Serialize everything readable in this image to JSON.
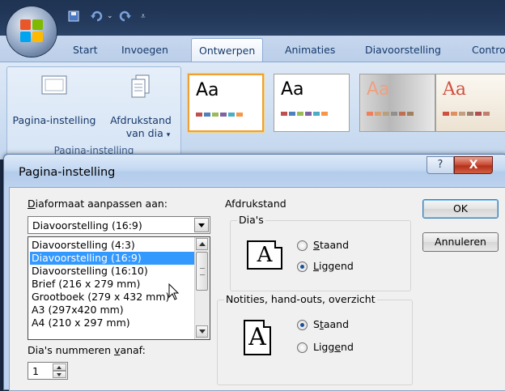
{
  "ribbon": {
    "tabs": [
      "Start",
      "Invoegen",
      "Ontwerpen",
      "Animaties",
      "Diavoorstelling",
      "Contro"
    ],
    "active_tab": "Ontwerpen",
    "page_setup_button": "Pagina-instelling",
    "orientation_button_line1": "Afdrukstand",
    "orientation_button_line2": "van dia",
    "group_label": "Pagina-instelling",
    "themes": [
      {
        "label": "Aa",
        "text_color": "#000000",
        "selected": true
      },
      {
        "label": "Aa",
        "text_color": "#000000",
        "selected": false
      },
      {
        "label": "Aa",
        "text_color": "#f0a080",
        "selected": false
      },
      {
        "label": "Aa",
        "text_color": "#d05040",
        "selected": false
      }
    ]
  },
  "dialog": {
    "title": "Pagina-instelling",
    "help_label": "?",
    "close_label": "X",
    "size_label_accel": "D",
    "size_label_rest": "iaformaat aanpassen aan:",
    "size_selected": "Diavoorstelling (16:9)",
    "size_options": [
      "Diavoorstelling (4:3)",
      "Diavoorstelling (16:9)",
      "Diavoorstelling (16:10)",
      "Brief (216 x 279 mm)",
      "Grootboek (279 x 432 mm)",
      "A3 (297x420 mm)",
      "A4 (210 x 297 mm)"
    ],
    "number_label_pre": "Dia's nummeren ",
    "number_label_accel": "v",
    "number_label_post": "anaf:",
    "number_value": "1",
    "orientation_title": "Afdrukstand",
    "slides_group": {
      "title": "Dia's",
      "icon_letter": "A",
      "option1_accel": "S",
      "option1_rest": "taand",
      "option2_accel": "L",
      "option2_rest": "iggend",
      "selected": "Liggend"
    },
    "notes_group": {
      "title": "Notities, hand-outs, overzicht",
      "icon_letter": "A",
      "option1_pre": "S",
      "option1_accel": "t",
      "option1_rest": "aand",
      "option2_pre": "Ligg",
      "option2_accel": "e",
      "option2_rest": "nd",
      "selected": "Staand"
    },
    "ok_label": "OK",
    "cancel_label": "Annuleren"
  },
  "colors": {
    "accent": "#3399ff",
    "theme_bar": [
      "#c0504d",
      "#9bbb59",
      "#8064a2",
      "#4bacc6",
      "#f79646",
      "#1f497d"
    ]
  }
}
